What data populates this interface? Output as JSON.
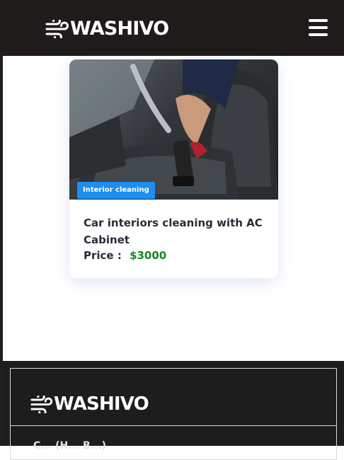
{
  "header": {
    "brand": "WASHIVO",
    "menu_icon": "hamburger-menu-icon"
  },
  "card": {
    "image_subject": "car-interior-vacuum-cleaning-photo",
    "badge": "Interior cleaning",
    "title": "Car interiors cleaning with AC Cabinet",
    "price_label": "Price :",
    "price_value": "$3000"
  },
  "footer": {
    "brand": "WASHIVO",
    "partial_text": "C... (H... B...)"
  },
  "colors": {
    "header_bg": "#1e1b1a",
    "badge_bg": "#1c8ff0",
    "price": "#0f8a1f"
  }
}
